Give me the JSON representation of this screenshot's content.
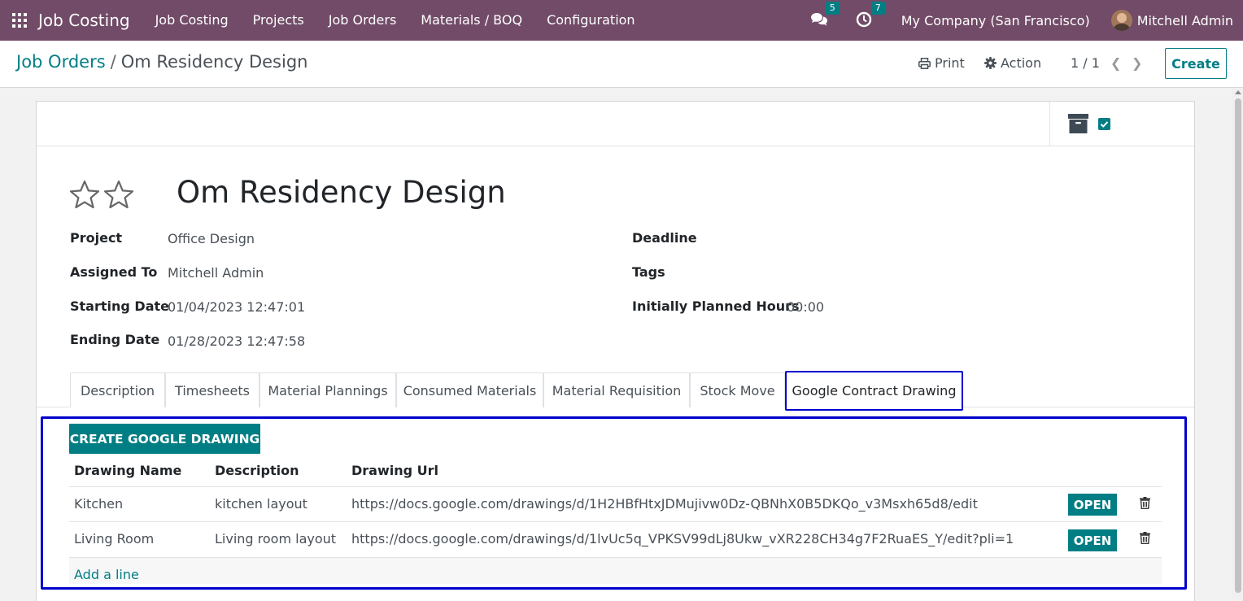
{
  "navbar": {
    "brand": "Job Costing",
    "menu": [
      "Job Costing",
      "Projects",
      "Job Orders",
      "Materials / BOQ",
      "Configuration"
    ],
    "messages_count": "5",
    "activities_count": "7",
    "company": "My Company (San Francisco)",
    "user": "Mitchell Admin"
  },
  "control_panel": {
    "breadcrumb_parent": "Job Orders",
    "breadcrumb_separator": "/",
    "breadcrumb_current": "Om Residency Design",
    "print_label": "Print",
    "action_label": "Action",
    "pager": "1 / 1",
    "create_label": "Create"
  },
  "record": {
    "title": "Om Residency Design",
    "fields_left": [
      {
        "label": "Project",
        "value": "Office Design"
      },
      {
        "label": "Assigned To",
        "value": "Mitchell Admin"
      },
      {
        "label": "Starting Date",
        "value": "01/04/2023 12:47:01"
      },
      {
        "label": "Ending Date",
        "value": "01/28/2023 12:47:58"
      }
    ],
    "fields_right": [
      {
        "label": "Deadline",
        "value": ""
      },
      {
        "label": "Tags",
        "value": ""
      },
      {
        "label": "Initially Planned Hours",
        "value": "00:00"
      }
    ]
  },
  "tabs": [
    "Description",
    "Timesheets",
    "Material Plannings",
    "Consumed Materials",
    "Material Requisition",
    "Stock Move",
    "Google Contract Drawing"
  ],
  "active_tab": "Google Contract Drawing",
  "drawings": {
    "create_button": "CREATE GOOGLE DRAWING",
    "columns": [
      "Drawing Name",
      "Description",
      "Drawing Url"
    ],
    "rows": [
      {
        "name": "Kitchen",
        "description": "kitchen layout",
        "url": "https://docs.google.com/drawings/d/1H2HBfHtxJDMujivw0Dz-QBNhX0B5DKQo_v3Msxh65d8/edit",
        "open_label": "OPEN"
      },
      {
        "name": "Living Room",
        "description": "Living room layout",
        "url": "https://docs.google.com/drawings/d/1lvUc5q_VPKSV99dLj8Ukw_vXR228CH34g7F2RuaES_Y/edit?pli=1",
        "open_label": "OPEN"
      }
    ],
    "add_line": "Add a line"
  },
  "colors": {
    "navbar": "#714b67",
    "primary": "#017e84",
    "highlight": "#0000cc"
  }
}
